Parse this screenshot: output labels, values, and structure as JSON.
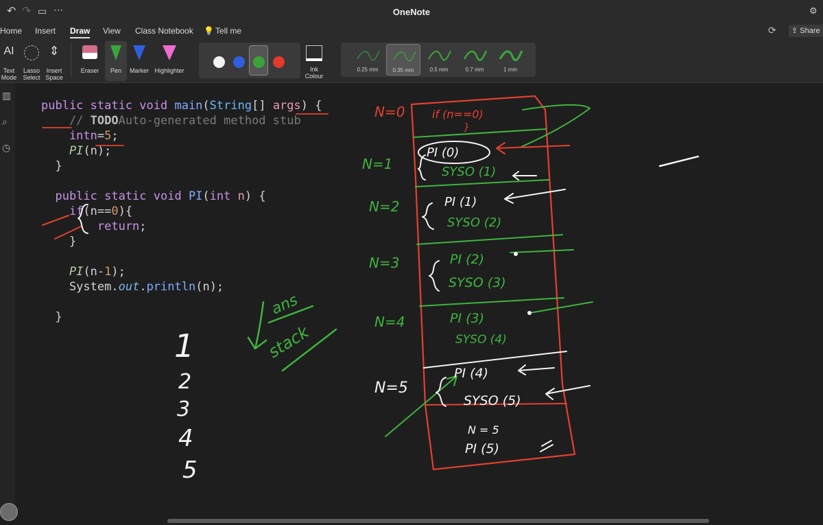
{
  "app": {
    "title": "OneNote"
  },
  "ribbon_tabs": [
    "Home",
    "Insert",
    "Draw",
    "View",
    "Class Notebook"
  ],
  "active_tab": "Draw",
  "tell_me": "Tell me",
  "share_label": "Share",
  "tools": {
    "text_mode": "Text Mode",
    "lasso_select": "Lasso Select",
    "insert_space": "Insert Space",
    "eraser": "Eraser",
    "pen": "Pen",
    "marker": "Marker",
    "highlighter": "Highlighter",
    "ink_colour": "Ink Colour"
  },
  "ink_colors": [
    "#f2f2f2",
    "#2f5fe0",
    "#3aa43a",
    "#e33a2a"
  ],
  "selected_ink_color": "#3aa43a",
  "pen_widths": [
    "0.25 mm",
    "0.35 mm",
    "0.5 mm",
    "0.7 mm",
    "1 mm"
  ],
  "selected_pen_width": "0.35 mm",
  "code_lines": [
    [
      {
        "t": "public static void ",
        "c": "kw"
      },
      {
        "t": "main",
        "c": "fn"
      },
      {
        "t": "(",
        "c": "tx"
      },
      {
        "t": "String",
        "c": "ty"
      },
      {
        "t": "[] ",
        "c": "tx"
      },
      {
        "t": "args",
        "c": "pr"
      },
      {
        "t": ") {",
        "c": "tx"
      }
    ],
    [
      {
        "t": "    // ",
        "c": "cm"
      },
      {
        "t": "TODO",
        "c": "cb"
      },
      {
        "t": "Auto-generated method stub",
        "c": "cm"
      }
    ],
    [
      {
        "t": "    intn",
        "c": "kw"
      },
      {
        "t": "=",
        "c": "tx"
      },
      {
        "t": "5",
        "c": "nm"
      },
      {
        "t": ";",
        "c": "tx"
      }
    ],
    [
      {
        "t": "    ",
        "c": "tx"
      },
      {
        "t": "PI",
        "c": "fi"
      },
      {
        "t": "(n);",
        "c": "tx"
      }
    ],
    [
      {
        "t": "  }",
        "c": "tx"
      }
    ],
    [
      {
        "t": "",
        "c": "tx"
      }
    ],
    [
      {
        "t": "  public static void ",
        "c": "kw"
      },
      {
        "t": "PI",
        "c": "fn"
      },
      {
        "t": "(",
        "c": "tx"
      },
      {
        "t": "int ",
        "c": "kw"
      },
      {
        "t": "n",
        "c": "pr"
      },
      {
        "t": ") {",
        "c": "tx"
      }
    ],
    [
      {
        "t": "    if",
        "c": "kw"
      },
      {
        "t": "(n==",
        "c": "tx"
      },
      {
        "t": "0",
        "c": "nm"
      },
      {
        "t": "){",
        "c": "tx"
      }
    ],
    [
      {
        "t": "        return",
        "c": "kw"
      },
      {
        "t": ";",
        "c": "tx"
      }
    ],
    [
      {
        "t": "    }",
        "c": "tx"
      }
    ],
    [
      {
        "t": "",
        "c": "tx"
      }
    ],
    [
      {
        "t": "    ",
        "c": "tx"
      },
      {
        "t": "PI",
        "c": "fi"
      },
      {
        "t": "(n-",
        "c": "tx"
      },
      {
        "t": "1",
        "c": "nm"
      },
      {
        "t": ");",
        "c": "tx"
      }
    ],
    [
      {
        "t": "    System.",
        "c": "tx"
      },
      {
        "t": "out",
        "c": "ob"
      },
      {
        "t": ".",
        "c": "tx"
      },
      {
        "t": "println",
        "c": "fn"
      },
      {
        "t": "(n);",
        "c": "tx"
      }
    ],
    [
      {
        "t": "",
        "c": "tx"
      }
    ],
    [
      {
        "t": "  }",
        "c": "tx"
      }
    ]
  ],
  "code_colors": {
    "kw": "#c792ea",
    "fn": "#82aaff",
    "ty": "#6cb6ff",
    "tx": "#d4d4d4",
    "pr": "#e89ab4",
    "cm": "#7a7a7a",
    "cb": "#bdbdbd",
    "nm": "#d19a66",
    "fi": "#b5cea8",
    "ob": "#7fb4e8"
  },
  "ink": {
    "output_numbers": [
      "1",
      "2",
      "3",
      "4",
      "5"
    ],
    "ans_note": "ans",
    "stack_note": "stack",
    "frame_labels": [
      "N=0",
      "N=1",
      "N=2",
      "N=3",
      "N=4",
      "N=5"
    ],
    "frame_calls": [
      "if (n==0)",
      "PI (0)",
      "PI (1)",
      "PI (2)",
      "PI (3)",
      "PI (4)",
      "PI (5)"
    ],
    "frame_prints": [
      "SYSO (1)",
      "SYSO (2)",
      "SYSO (3)",
      "SYSO (4)",
      "SYSO (5)"
    ],
    "closing_brace": "}",
    "base_note": "N = 5",
    "colors": {
      "red": "#e4412f",
      "green": "#3fb43f",
      "white": "#f4f4f4"
    }
  }
}
